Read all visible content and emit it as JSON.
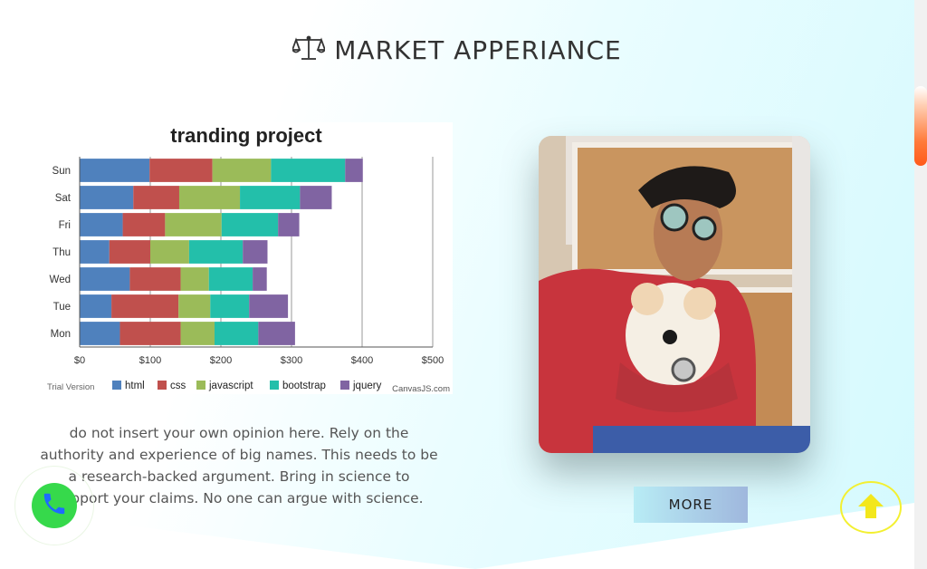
{
  "section": {
    "title": "MARKET APPERIANCE",
    "title_icon": "balance-scale-icon",
    "description": "do not insert your own opinion here. Rely on the authority and experience of big names. This needs to be a research-backed argument. Bring in science to support your claims. No one can argue with science.",
    "more_label": "MORE"
  },
  "chart_watermarks": {
    "trial": "Trial Version",
    "brand": "CanvasJS.com"
  },
  "chart_data": {
    "type": "bar",
    "orientation": "horizontal",
    "stacked": true,
    "title": "tranding project",
    "categories": [
      "Sun",
      "Sat",
      "Fri",
      "Thu",
      "Wed",
      "Tue",
      "Mon"
    ],
    "x_ticks": [
      "$0",
      "$100",
      "$200",
      "$300",
      "$400",
      "$500"
    ],
    "xlim": [
      0,
      500
    ],
    "legend": "bottom",
    "grid": true,
    "series": [
      {
        "name": "html",
        "color": "#4f81bd",
        "values": [
          99,
          76,
          61,
          42,
          71,
          45,
          57
        ]
      },
      {
        "name": "css",
        "color": "#c0504d",
        "values": [
          89,
          65,
          60,
          58,
          72,
          95,
          86
        ]
      },
      {
        "name": "javascript",
        "color": "#9bbb59",
        "values": [
          83,
          86,
          80,
          55,
          40,
          45,
          48
        ]
      },
      {
        "name": "bootstrap",
        "color": "#23bfaa",
        "values": [
          105,
          85,
          80,
          76,
          62,
          55,
          62
        ]
      },
      {
        "name": "jquery",
        "color": "#8064a2",
        "values": [
          25,
          45,
          30,
          35,
          20,
          55,
          52
        ]
      }
    ]
  },
  "widgets": {
    "call_icon": "phone-icon",
    "scroll_top_icon": "arrow-up-icon"
  }
}
